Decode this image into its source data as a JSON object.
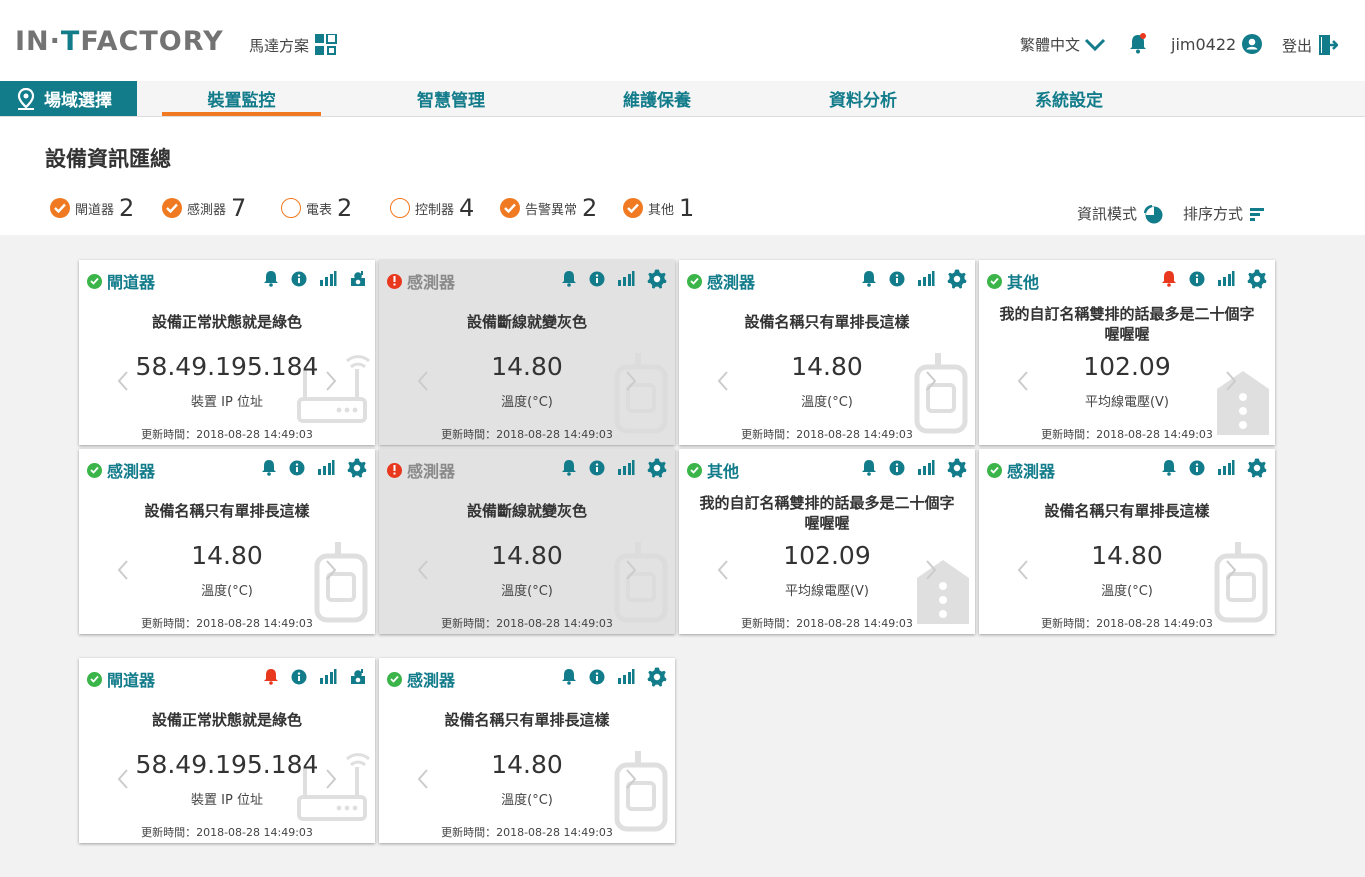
{
  "header": {
    "logo_left": "IN·",
    "logo_t": "T",
    "logo_right": "FACTORY",
    "plan_label": "馬達方案",
    "language": "繁體中文",
    "username": "jim0422",
    "logout": "登出"
  },
  "nav": {
    "site_select": "場域選擇",
    "tabs": [
      {
        "label": "裝置監控",
        "active": true
      },
      {
        "label": "智慧管理",
        "active": false
      },
      {
        "label": "維護保養",
        "active": false
      },
      {
        "label": "資料分析",
        "active": false
      },
      {
        "label": "系統設定",
        "active": false
      }
    ]
  },
  "page": {
    "title": "設備資訊匯總",
    "info_mode": "資訊模式",
    "sort_mode": "排序方式"
  },
  "filters": [
    {
      "label": "閘道器",
      "count": "2",
      "checked": true
    },
    {
      "label": "感測器",
      "count": "7",
      "checked": true
    },
    {
      "label": "電表",
      "count": "2",
      "checked": false
    },
    {
      "label": "控制器",
      "count": "4",
      "checked": false
    },
    {
      "label": "告警異常",
      "count": "2",
      "checked": true
    },
    {
      "label": "其他",
      "count": "1",
      "checked": true
    }
  ],
  "cards": [
    {
      "type": "閘道器",
      "status": "ok",
      "name": "設備正常狀態就是綠色",
      "value": "58.49.195.184",
      "unit": "裝置 IP 位址",
      "time": "更新時間：2018-08-28 14:49:03",
      "alert": false,
      "kind": "gateway",
      "offline": false
    },
    {
      "type": "感測器",
      "status": "err",
      "name": "設備斷線就變灰色",
      "value": "14.80",
      "unit": "溫度(°C)",
      "time": "更新時間：2018-08-28 14:49:03",
      "alert": false,
      "kind": "sensor",
      "offline": true
    },
    {
      "type": "感測器",
      "status": "ok",
      "name": "設備名稱只有單排長這樣",
      "value": "14.80",
      "unit": "溫度(°C)",
      "time": "更新時間：2018-08-28 14:49:03",
      "alert": false,
      "kind": "sensor",
      "offline": false
    },
    {
      "type": "其他",
      "status": "ok",
      "name": "我的自訂名稱雙排的話最多是二十個字喔喔喔",
      "value": "102.09",
      "unit": "平均線電壓(V)",
      "time": "更新時間：2018-08-28 14:49:03",
      "alert": true,
      "kind": "other",
      "offline": false
    },
    {
      "type": "感測器",
      "status": "ok",
      "name": "設備名稱只有單排長這樣",
      "value": "14.80",
      "unit": "溫度(°C)",
      "time": "更新時間：2018-08-28 14:49:03",
      "alert": false,
      "kind": "sensor",
      "offline": false
    },
    {
      "type": "感測器",
      "status": "err",
      "name": "設備斷線就變灰色",
      "value": "14.80",
      "unit": "溫度(°C)",
      "time": "更新時間：2018-08-28 14:49:03",
      "alert": false,
      "kind": "sensor",
      "offline": true
    },
    {
      "type": "其他",
      "status": "ok",
      "name": "我的自訂名稱雙排的話最多是二十個字喔喔喔",
      "value": "102.09",
      "unit": "平均線電壓(V)",
      "time": "更新時間：2018-08-28 14:49:03",
      "alert": false,
      "kind": "other",
      "offline": false
    },
    {
      "type": "感測器",
      "status": "ok",
      "name": "設備名稱只有單排長這樣",
      "value": "14.80",
      "unit": "溫度(°C)",
      "time": "更新時間：2018-08-28 14:49:03",
      "alert": false,
      "kind": "sensor",
      "offline": false
    },
    {
      "type": "閘道器",
      "status": "ok",
      "name": "設備正常狀態就是綠色",
      "value": "58.49.195.184",
      "unit": "裝置 IP 位址",
      "time": "更新時間：2018-08-28 14:49:03",
      "alert": true,
      "kind": "gateway",
      "offline": false
    },
    {
      "type": "感測器",
      "status": "ok",
      "name": "設備名稱只有單排長這樣",
      "value": "14.80",
      "unit": "溫度(°C)",
      "time": "更新時間：2018-08-28 14:49:03",
      "alert": false,
      "kind": "sensor",
      "offline": false
    }
  ],
  "colors": {
    "teal": "#137c8b",
    "orange": "#f07a21",
    "ok_green": "#3bb54a",
    "alert_red": "#e8381d",
    "offline_gray": "#e2e2e2"
  }
}
